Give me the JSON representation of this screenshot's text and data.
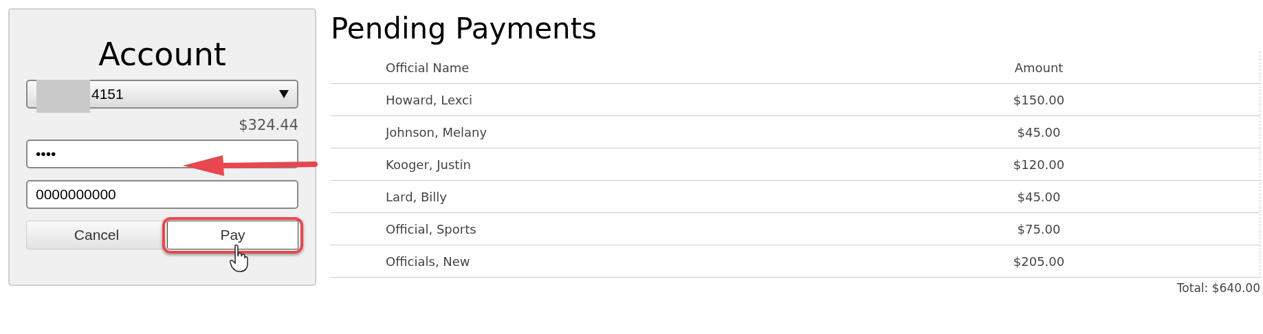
{
  "account": {
    "title": "Account",
    "account_select": "4151",
    "balance": "$324.44",
    "pin": "••••",
    "account_number": "0000000000",
    "buttons": [
      {
        "label": "Cancel",
        "highlighted": false
      },
      {
        "label": "Pay",
        "highlighted": true
      }
    ]
  },
  "payments": {
    "title": "Pending Payments",
    "columns": [
      "Official Name",
      "Amount"
    ],
    "rows": [
      {
        "name": "Howard, Lexci",
        "amount": "$150.00"
      },
      {
        "name": "Johnson, Melany",
        "amount": "$45.00"
      },
      {
        "name": "Kooger, Justin",
        "amount": "$120.00"
      },
      {
        "name": "Lard, Billy",
        "amount": "$45.00"
      },
      {
        "name": "Official, Sports",
        "amount": "$75.00"
      },
      {
        "name": "Officials, New",
        "amount": "$205.00"
      }
    ],
    "total": "Total: $640.00"
  }
}
